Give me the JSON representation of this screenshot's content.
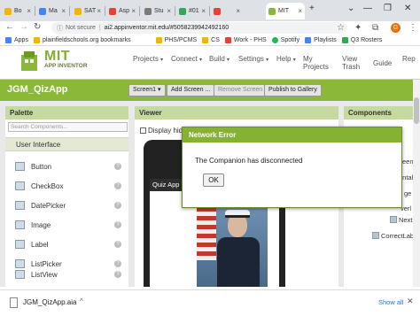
{
  "browser": {
    "tabs": [
      {
        "label": "Bo",
        "color": "#f4b400"
      },
      {
        "label": "Ma",
        "color": "#4285f4"
      },
      {
        "label": "SAT",
        "color": "#f4b400"
      },
      {
        "label": "Asp",
        "color": "#e94235"
      },
      {
        "label": "Stu",
        "color": "#7a7a7a"
      },
      {
        "label": "#01",
        "color": "#34a853"
      },
      {
        "label": "",
        "color": "#e94235"
      },
      {
        "label": "MIT",
        "color": "#8cb83a"
      }
    ],
    "new_tab": "+",
    "window_controls": [
      "⌄",
      "—",
      "❐",
      "✕"
    ],
    "address": {
      "security": "Not secure",
      "separator": "|",
      "url": "ai2.appinventor.mit.edu/#5058239942492160"
    },
    "profile_initial": "G",
    "bookmarks": [
      {
        "label": "Apps",
        "color": "#4285f4"
      },
      {
        "label": "plainfieldschools.org bookmarks",
        "color": "#f4b400"
      },
      {
        "label": "PHS/PCMS",
        "color": "#f4b400"
      },
      {
        "label": "CS",
        "color": "#f4b400"
      },
      {
        "label": "Work - PHS",
        "color": "#e94235"
      },
      {
        "label": "Spotify",
        "color": "#1db954"
      },
      {
        "label": "Playlists",
        "color": "#4285f4"
      },
      {
        "label": "Q3 Rosters",
        "color": "#34a853"
      }
    ]
  },
  "appinventor": {
    "logo_title": "MIT",
    "logo_subtitle": "APP INVENTOR",
    "menus": [
      "Projects",
      "Connect",
      "Build",
      "Settings",
      "Help",
      "My\nProjects",
      "View\nTrash",
      "Guide",
      "Rep"
    ],
    "project_name": "JGM_QizApp",
    "screen_select": "Screen1",
    "buttons": {
      "add_screen": "Add Screen ...",
      "remove_screen": "Remove Screen",
      "publish": "Publish to Gallery"
    },
    "palette": {
      "title": "Palette",
      "search_placeholder": "Search Components...",
      "category": "User Interface",
      "items": [
        "Button",
        "CheckBox",
        "DatePicker",
        "Image",
        "Label",
        "ListPicker",
        "ListView"
      ]
    },
    "viewer": {
      "title": "Viewer",
      "display_hidden": "Display hidde",
      "screen_title": "Quiz App"
    },
    "components": {
      "title": "Components",
      "items": [
        "eenLa",
        "ontalA",
        "ge",
        "verl",
        "NextBu",
        "CorrectLab"
      ]
    }
  },
  "modal": {
    "title": "Network Error",
    "message": "The Companion has disconnected",
    "ok_label": "OK"
  },
  "downloads": {
    "file_name": "JGM_QizApp.aia",
    "show_all": "Show all"
  }
}
